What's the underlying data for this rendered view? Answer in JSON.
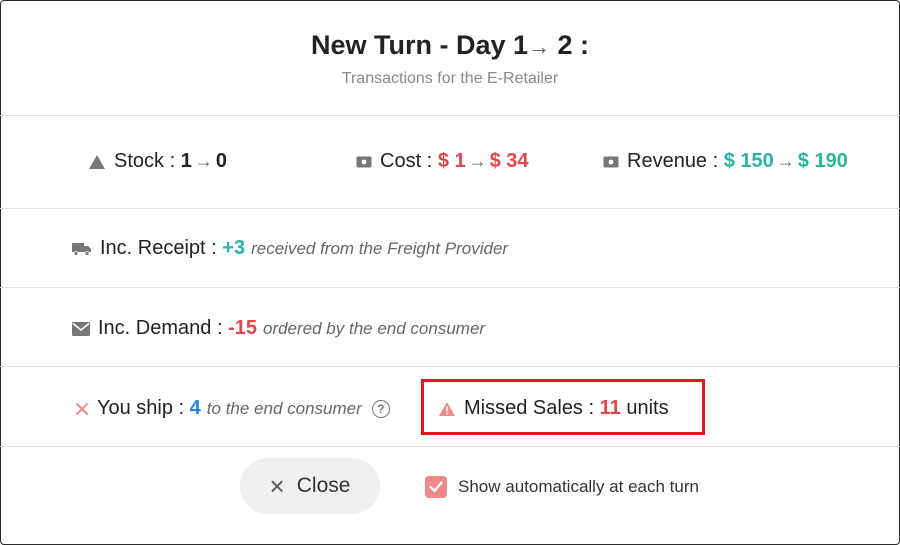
{
  "header": {
    "title_prefix": "New Turn - Day 1",
    "title_arrow": "→",
    "title_suffix": "2 :",
    "subtitle": "Transactions for the E-Retailer"
  },
  "stats": {
    "stock": {
      "label": "Stock :",
      "from": "1",
      "arrow": "→",
      "to": "0",
      "icon": "triangle-icon"
    },
    "cost": {
      "label": "Cost :",
      "from": "$ 1",
      "arrow": "→",
      "to": "$ 34",
      "icon": "money-icon"
    },
    "revenue": {
      "label": "Revenue :",
      "from": "$ 150",
      "arrow": "→",
      "to": "$ 190",
      "icon": "money-icon"
    }
  },
  "receipt": {
    "label": "Inc. Receipt :",
    "value": "+3",
    "desc": "received from the Freight Provider",
    "icon": "truck-icon"
  },
  "demand": {
    "label": "Inc. Demand :",
    "value": "-15",
    "desc": "ordered by the end consumer",
    "icon": "envelope-icon"
  },
  "ship": {
    "label": "You ship :",
    "value": "4",
    "desc": "to the end consumer",
    "help": "?",
    "icon": "x-icon"
  },
  "missed": {
    "label": "Missed Sales :",
    "value": "11",
    "unit": "units",
    "icon": "warning-icon"
  },
  "footer": {
    "close_label": "Close",
    "close_icon": "×",
    "auto_show_label": "Show automatically at each turn",
    "auto_show_checked": true
  },
  "colors": {
    "red": "#e0474c",
    "teal": "#2bb3a3",
    "blue": "#2a84d8",
    "highlight": "#e0171d"
  }
}
